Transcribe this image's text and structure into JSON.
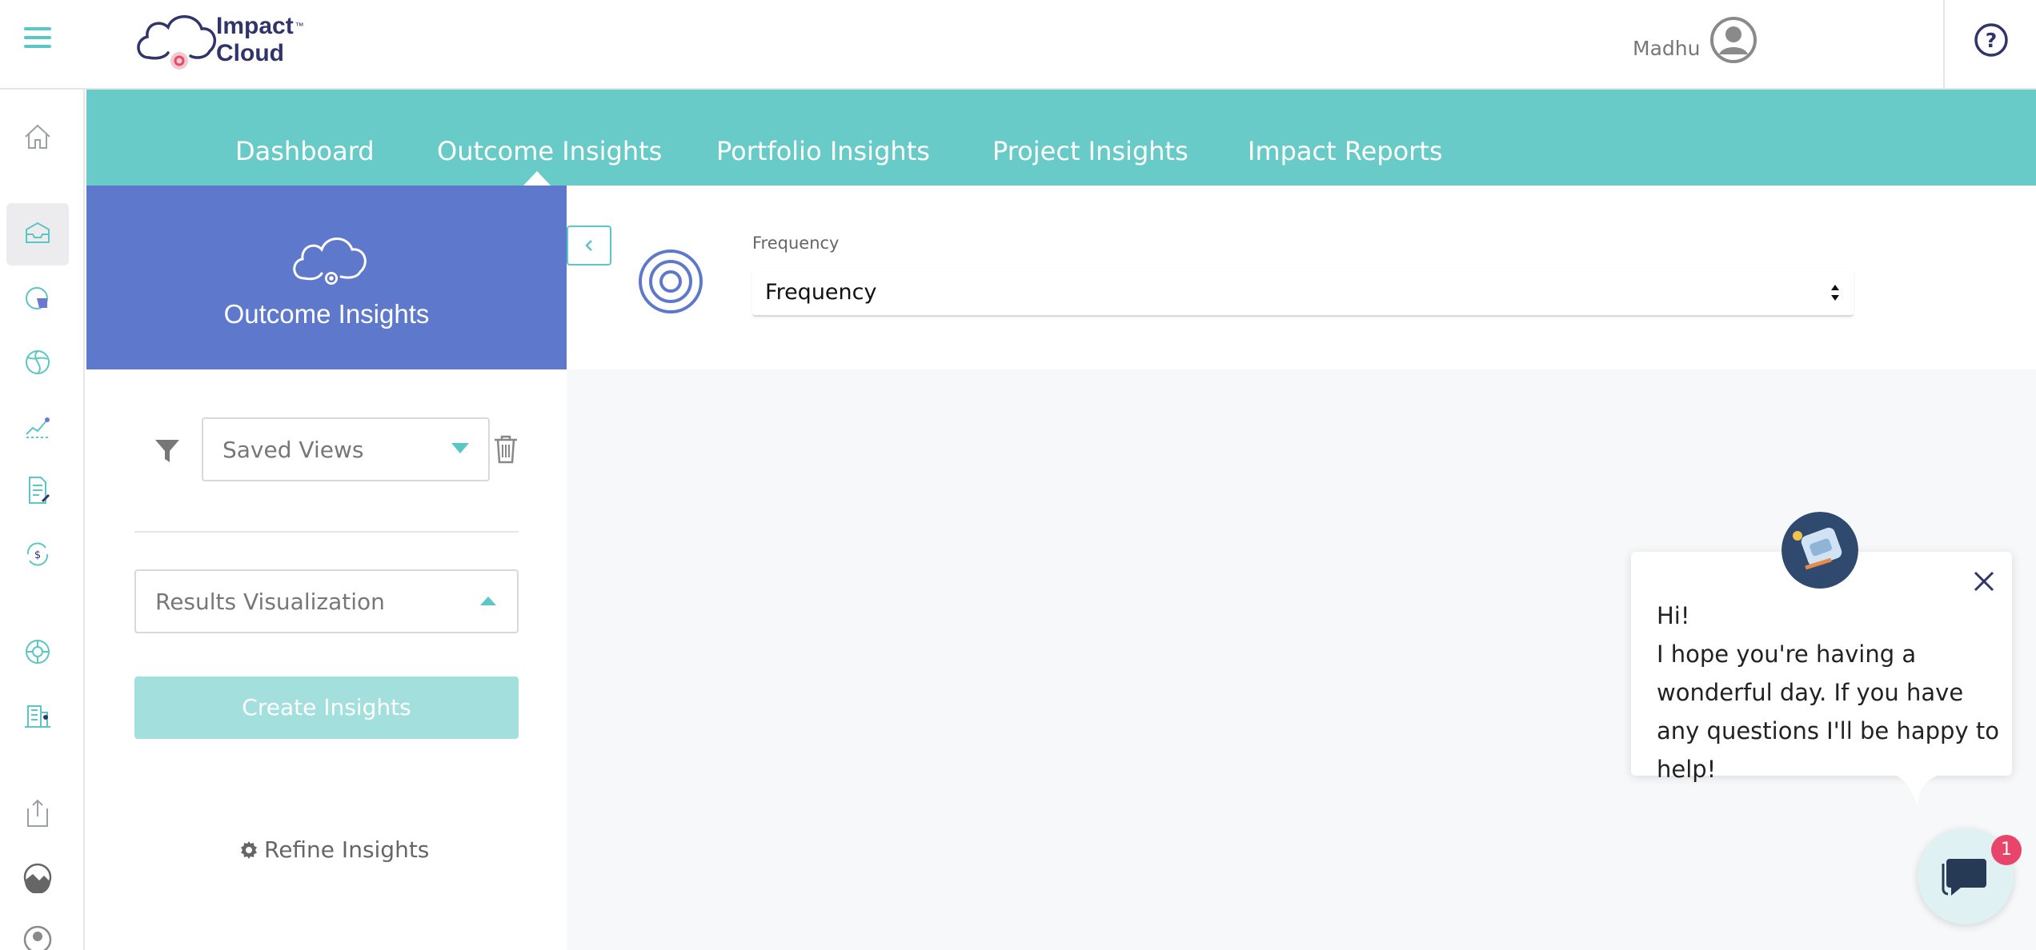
{
  "app": {
    "logo_line1": "Impact",
    "logo_line2": "Cloud",
    "logo_tm": "™"
  },
  "header": {
    "user_name": "Madhu"
  },
  "nav": {
    "items": [
      {
        "label": "Dashboard"
      },
      {
        "label": "Outcome Insights"
      },
      {
        "label": "Portfolio Insights"
      },
      {
        "label": "Project Insights"
      },
      {
        "label": "Impact Reports"
      }
    ],
    "active": "Outcome Insights"
  },
  "panel": {
    "title": "Outcome Insights",
    "saved_views_label": "Saved Views",
    "results_visualization_label": "Results Visualization",
    "create_button_label": "Create Insights",
    "refine_label": "Refine Insights"
  },
  "filters": {
    "frequency_label": "Frequency",
    "frequency_value": "Frequency"
  },
  "chat": {
    "greeting": "Hi!",
    "message": "I hope you're having a wonderful day. If you have any questions I'll be happy to help!",
    "badge_count": "1"
  },
  "rail": {
    "icons": [
      "home-icon",
      "inbox-icon",
      "pie-chart-icon",
      "globe-icon",
      "trend-chart-icon",
      "document-edit-icon",
      "currency-cycle-icon",
      "lifebuoy-icon",
      "building-icon",
      "export-icon",
      "landscape-icon",
      "user-circle-icon"
    ]
  },
  "colors": {
    "teal": "#69cbc8",
    "accent_teal": "#5bc7c4",
    "hero_blue": "#5e78cc",
    "brand_navy": "#31336b",
    "button_disabled": "#a3dfdd",
    "badge_red": "#e9456a"
  }
}
